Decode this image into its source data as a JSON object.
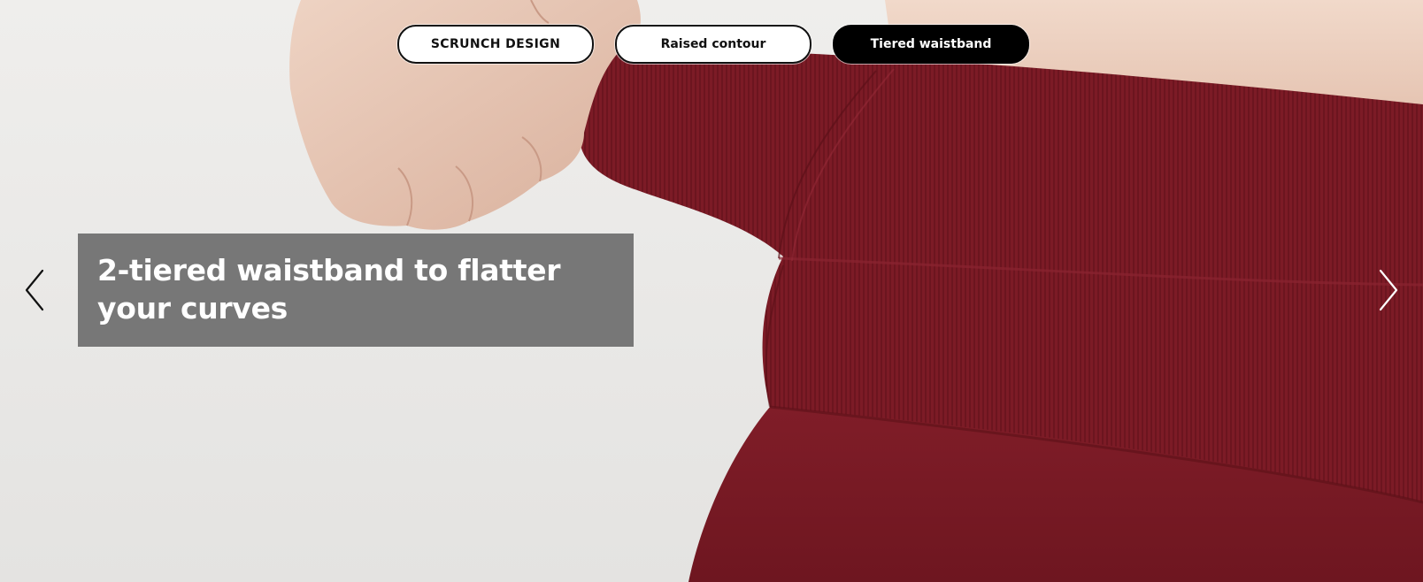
{
  "tabs": [
    {
      "label": "SCRUNCH DESIGN",
      "selected": false
    },
    {
      "label": "Raised contour",
      "selected": false
    },
    {
      "label": "Tiered waistband",
      "selected": true
    }
  ],
  "slide": {
    "caption": "2-tiered waistband to flatter your curves"
  },
  "navigation": {
    "prev_icon": "chevron-left-icon",
    "next_icon": "chevron-right-icon"
  },
  "colors": {
    "fabric": "#7e1c27",
    "caption_bg": "#707070",
    "tab_selected_bg": "#000000",
    "tab_bg": "#ffffff"
  }
}
